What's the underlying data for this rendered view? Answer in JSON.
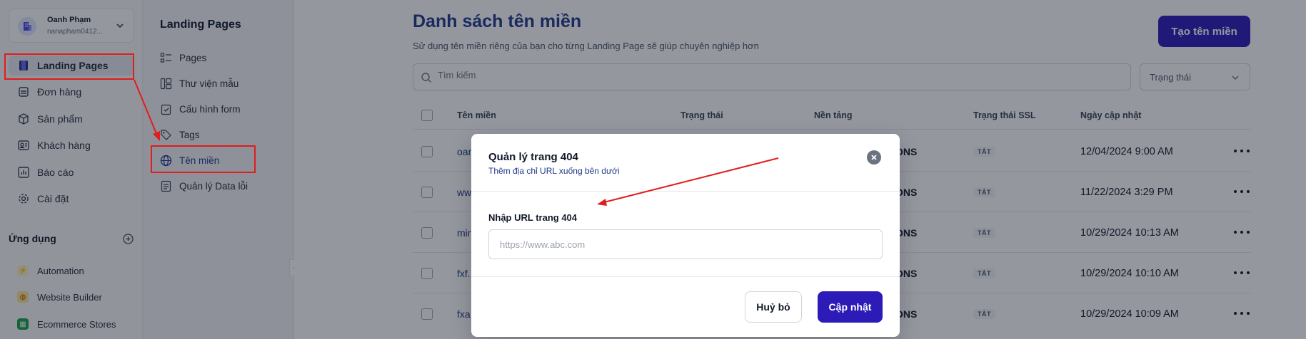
{
  "account": {
    "name": "Oanh Phạm",
    "email": "nanapham0412..."
  },
  "sidebar": {
    "items": [
      {
        "label": "Landing Pages",
        "icon": "landing-pages-icon",
        "active": true
      },
      {
        "label": "Đơn hàng",
        "icon": "orders-icon"
      },
      {
        "label": "Sản phẩm",
        "icon": "box-icon"
      },
      {
        "label": "Khách hàng",
        "icon": "contact-card-icon"
      },
      {
        "label": "Báo cáo",
        "icon": "bar-chart-icon"
      },
      {
        "label": "Cài đặt",
        "icon": "gear-icon"
      }
    ],
    "apps_title": "Ứng dụng",
    "apps": [
      {
        "label": "Automation",
        "icon": "lightning-icon",
        "color": "#f59e0b"
      },
      {
        "label": "Website Builder",
        "icon": "globe-icon",
        "color": "#d97706"
      },
      {
        "label": "Ecommerce Stores",
        "icon": "store-icon",
        "color": "#16a34a"
      }
    ]
  },
  "subnav": {
    "title": "Landing Pages",
    "items": [
      {
        "label": "Pages",
        "icon": "list-icon"
      },
      {
        "label": "Thư viện mẫu",
        "icon": "template-icon"
      },
      {
        "label": "Cấu hình form",
        "icon": "clipboard-check-icon"
      },
      {
        "label": "Tags",
        "icon": "tags-icon"
      },
      {
        "label": "Tên miền",
        "icon": "www-globe-icon",
        "active": true
      },
      {
        "label": "Quản lý Data lỗi",
        "icon": "document-icon"
      }
    ]
  },
  "main": {
    "title": "Danh sách tên miền",
    "subtitle": "Sử dụng tên miền riêng của bạn cho từng Landing Page sẽ giúp chuyên nghiệp hơn",
    "create_button": "Tạo tên miền",
    "search_placeholder": "Tìm kiếm",
    "status_filter": "Trạng thái",
    "columns": [
      "Tên miền",
      "Trạng thái",
      "Nền tảng",
      "Trạng thái SSL",
      "Ngày cập nhật"
    ],
    "rows": [
      {
        "domain": "oan",
        "platform": "ONS",
        "ssl": "TẮT",
        "updated": "12/04/2024 9:00 AM"
      },
      {
        "domain": "ww",
        "platform": "ONS",
        "ssl": "TẮT",
        "updated": "11/22/2024 3:29 PM"
      },
      {
        "domain": "min",
        "platform": "ONS",
        "ssl": "TẮT",
        "updated": "10/29/2024 10:13 AM"
      },
      {
        "domain": "fxf.",
        "platform": "ONS",
        "ssl": "TẮT",
        "updated": "10/29/2024 10:10 AM"
      },
      {
        "domain": "fxa",
        "platform": "ONS",
        "ssl": "TẮT",
        "updated": "10/29/2024 10:09 AM"
      }
    ]
  },
  "modal": {
    "title": "Quản lý trang 404",
    "subtitle": "Thêm địa chỉ URL xuống bên dưới",
    "field_label": "Nhập URL trang 404",
    "url_placeholder": "https://www.abc.com",
    "url_value": "",
    "cancel_label": "Huỷ bỏ",
    "update_label": "Cập nhật"
  },
  "colors": {
    "primary": "#2d1bb8",
    "annotation": "#e11d1d",
    "link": "#1e3a8a"
  }
}
